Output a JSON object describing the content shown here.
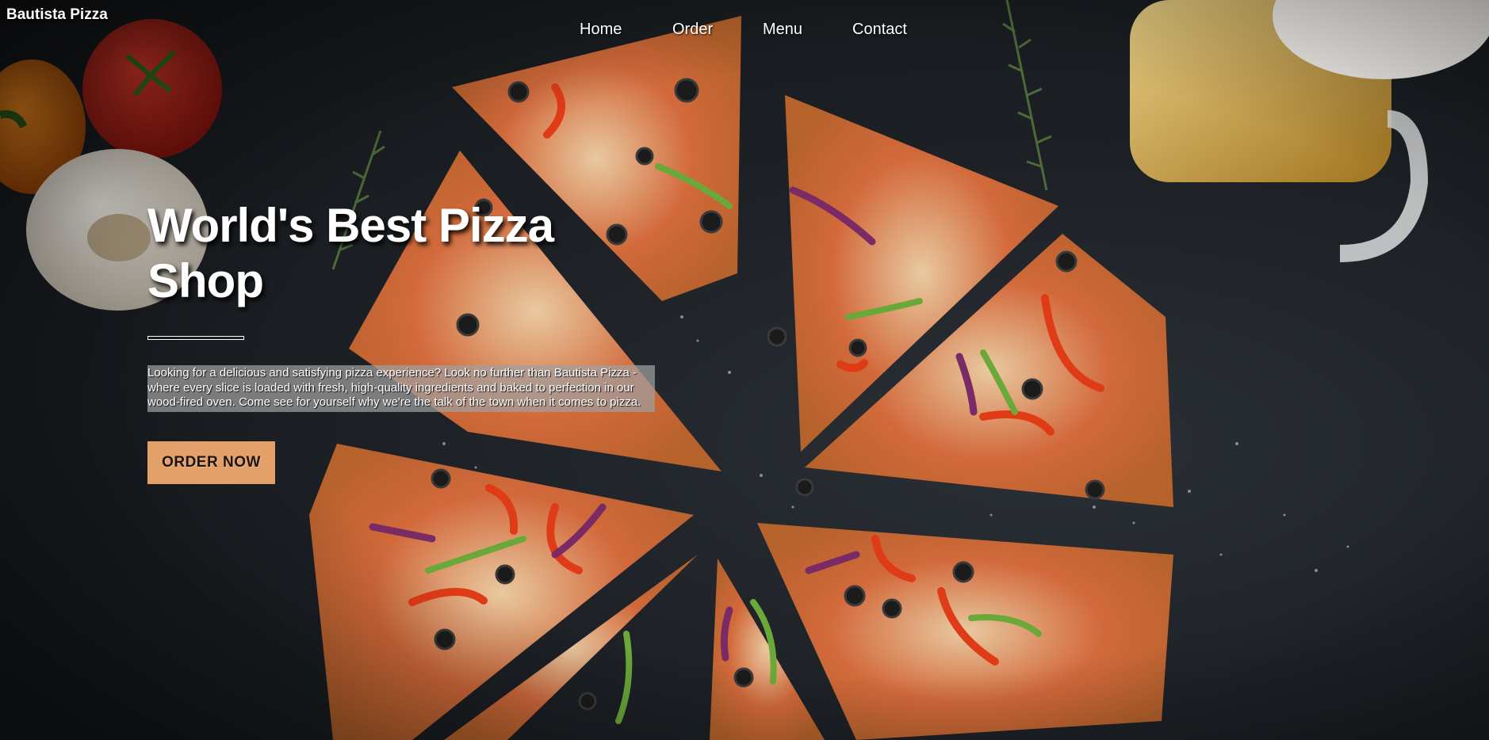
{
  "brand": {
    "name": "Bautista Pizza"
  },
  "nav": {
    "items": [
      {
        "label": "Home"
      },
      {
        "label": "Order"
      },
      {
        "label": "Menu"
      },
      {
        "label": "Contact"
      }
    ]
  },
  "hero": {
    "headline": "World's Best Pizza Shop",
    "intro": "Looking for a delicious and satisfying pizza experience? Look no further than Bautista Pizza - where every slice is loaded with fresh, high-quality ingredients and baked to perfection in our wood-fired oven. Come see for yourself why we're the talk of the town when it comes to pizza.",
    "cta_label": "ORDER NOW",
    "background_image": "pizza-hero-photo"
  },
  "colors": {
    "cta_background": "#e3a069",
    "background": "#1c1f23",
    "intro_box": "#a0a0a0"
  }
}
